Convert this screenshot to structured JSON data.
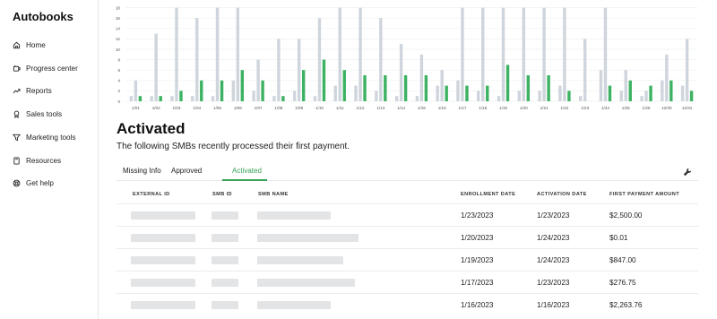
{
  "app": {
    "name": "Autobooks"
  },
  "sidebar": {
    "items": [
      {
        "label": "Home",
        "icon": "home-icon"
      },
      {
        "label": "Progress center",
        "icon": "progress-icon"
      },
      {
        "label": "Reports",
        "icon": "trend-icon"
      },
      {
        "label": "Sales tools",
        "icon": "award-icon"
      },
      {
        "label": "Marketing tools",
        "icon": "filter-icon"
      },
      {
        "label": "Resources",
        "icon": "book-icon"
      },
      {
        "label": "Get help",
        "icon": "help-icon"
      }
    ]
  },
  "chart_data": {
    "type": "bar",
    "categories": [
      "1/01",
      "1/02",
      "1/03",
      "1/04",
      "1/05",
      "1/06",
      "1/07",
      "1/08",
      "1/09",
      "1/10",
      "1/11",
      "1/12",
      "1/13",
      "1/14",
      "1/15",
      "1/16",
      "1/17",
      "1/18",
      "1/19",
      "1/20",
      "1/21",
      "1/22",
      "1/23",
      "1/24",
      "1/25",
      "1/26",
      "12/30",
      "12/31"
    ],
    "y_ticks": [
      0,
      2,
      4,
      6,
      8,
      10,
      12,
      14,
      16,
      18
    ],
    "ylim": [
      0,
      18
    ],
    "series": [
      {
        "color": "#cfd5dc",
        "values": [
          1,
          1,
          1,
          1,
          1,
          4,
          2,
          1,
          2,
          1,
          3,
          3,
          2,
          1,
          1,
          3,
          4,
          2,
          1,
          2,
          2,
          3,
          1,
          6,
          2,
          1,
          4,
          3
        ]
      },
      {
        "color": "#cfd5dc",
        "values": [
          4,
          13,
          18,
          16,
          18,
          18,
          8,
          12,
          12,
          16,
          18,
          18,
          16,
          11,
          9,
          6,
          18,
          18,
          18,
          18,
          18,
          18,
          12,
          18,
          6,
          2,
          9,
          12
        ]
      },
      {
        "color": "#3cb262",
        "values": [
          1,
          1,
          2,
          4,
          4,
          6,
          4,
          1,
          6,
          8,
          6,
          5,
          5,
          5,
          5,
          3,
          3,
          3,
          7,
          5,
          5,
          2,
          0,
          3,
          4,
          3,
          4,
          2
        ]
      }
    ]
  },
  "activated": {
    "title": "Activated",
    "subtitle": "The following SMBs recently processed their first payment."
  },
  "tabs": [
    {
      "label": "Missing Info"
    },
    {
      "label": "Approved"
    },
    {
      "label": "Activated"
    }
  ],
  "table": {
    "columns": [
      "EXTERNAL ID",
      "SMB ID",
      "SMB NAME",
      "ENROLLMENT DATE",
      "ACTIVATION DATE",
      "FIRST PAYMENT AMOUNT"
    ],
    "rows": [
      {
        "enrollment_date": "1/23/2023",
        "activation_date": "1/23/2023",
        "first_payment": "$2,500.00"
      },
      {
        "enrollment_date": "1/20/2023",
        "activation_date": "1/24/2023",
        "first_payment": "$0.01"
      },
      {
        "enrollment_date": "1/19/2023",
        "activation_date": "1/24/2023",
        "first_payment": "$847.00"
      },
      {
        "enrollment_date": "1/17/2023",
        "activation_date": "1/23/2023",
        "first_payment": "$276.75"
      },
      {
        "enrollment_date": "1/16/2023",
        "activation_date": "1/16/2023",
        "first_payment": "$2,263.76"
      }
    ]
  }
}
